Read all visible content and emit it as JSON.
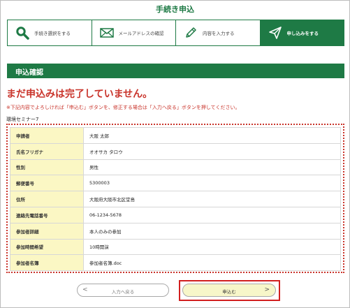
{
  "page_title": "手続き申込",
  "steps": [
    {
      "label": "手続き選択をする",
      "icon": "search-icon",
      "active": false
    },
    {
      "label": "メールアドレスの確認",
      "icon": "mail-icon",
      "active": false
    },
    {
      "label": "内容を入力する",
      "icon": "pencil-icon",
      "active": false
    },
    {
      "label": "申し込みをする",
      "icon": "send-icon",
      "active": true
    }
  ],
  "section": {
    "title": "申込確認"
  },
  "warning": {
    "title": "まだ申込みは完了していません。",
    "note": "※下記内容でよろしければ「申込む」ボタンを、修正する場合は「入力へ戻る」ボタンを押してください。"
  },
  "event_name": "環境セミナー7",
  "rows": [
    {
      "label": "申請者",
      "value": "大阪 太郎"
    },
    {
      "label": "氏名フリガナ",
      "value": "オオサカ タロウ"
    },
    {
      "label": "性別",
      "value": "男性"
    },
    {
      "label": "郵便番号",
      "value": "5300003"
    },
    {
      "label": "住所",
      "value": "大阪府大阪市北区堂島"
    },
    {
      "label": "連絡先電話番号",
      "value": "06-1234-5678"
    },
    {
      "label": "参加者詳細",
      "value": "本人のみの参加"
    },
    {
      "label": "参加時間希望",
      "value": "10時開演"
    },
    {
      "label": "参加者名簿",
      "value": "参加者名簿.doc"
    }
  ],
  "buttons": {
    "back": {
      "label": "入力へ戻る",
      "arrow": "<"
    },
    "submit": {
      "label": "申込む",
      "arrow": ">"
    }
  },
  "colors": {
    "brand_green": "#1e7a45",
    "warning_red": "#c9342b",
    "label_bg": "#fbf7c4",
    "highlight_red": "#d21f1f"
  }
}
